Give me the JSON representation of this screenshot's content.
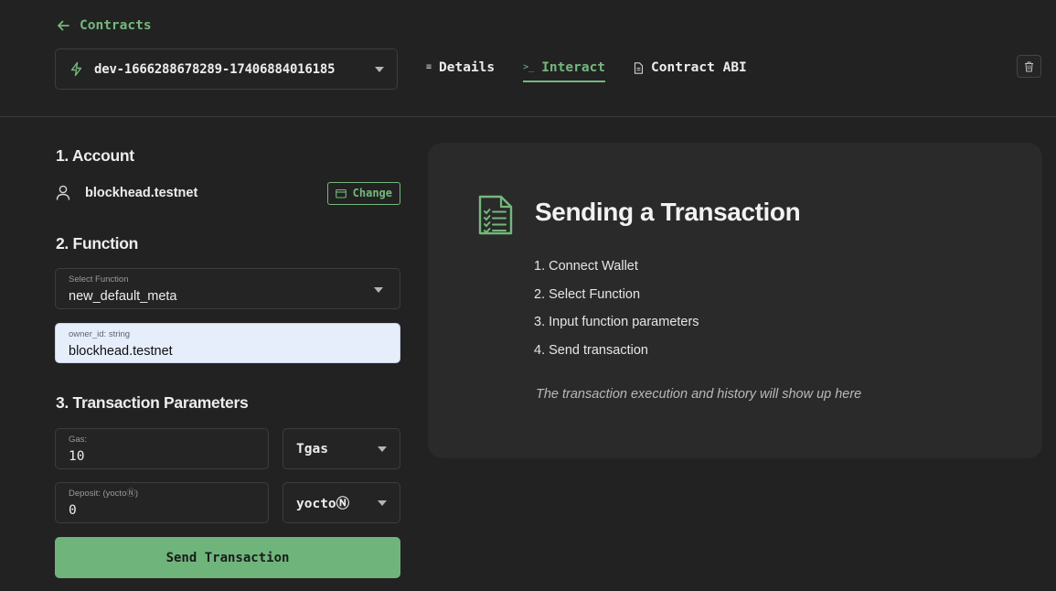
{
  "nav": {
    "back_label": "Contracts"
  },
  "contract": {
    "name": "dev-1666288678289-17406884016185"
  },
  "tabs": [
    {
      "label": "Details",
      "icon": "list-icon"
    },
    {
      "label": "Interact",
      "icon": "terminal-icon",
      "active": true
    },
    {
      "label": "Contract ABI",
      "icon": "file-icon"
    }
  ],
  "account": {
    "section_title": "1. Account",
    "name": "blockhead.testnet",
    "change_label": "Change"
  },
  "function": {
    "section_title": "2. Function",
    "select_label": "Select Function",
    "selected": "new_default_meta",
    "param_label": "owner_id: string",
    "param_value": "blockhead.testnet"
  },
  "params": {
    "section_title": "3. Transaction Parameters",
    "gas_label": "Gas:",
    "gas_value": "10",
    "gas_unit": "Tgas",
    "deposit_label": "Deposit: (yoctoⓃ)",
    "deposit_value": "0",
    "deposit_unit": "yoctoⓃ",
    "send_label": "Send Transaction"
  },
  "guide": {
    "title": "Sending a Transaction",
    "steps": [
      "1. Connect Wallet",
      "2. Select Function",
      "3. Input function parameters",
      "4. Send transaction"
    ],
    "note": "The transaction execution and history will show up here"
  },
  "colors": {
    "accent": "#74b87c",
    "background": "#222222",
    "panel": "#2a2a2a"
  }
}
